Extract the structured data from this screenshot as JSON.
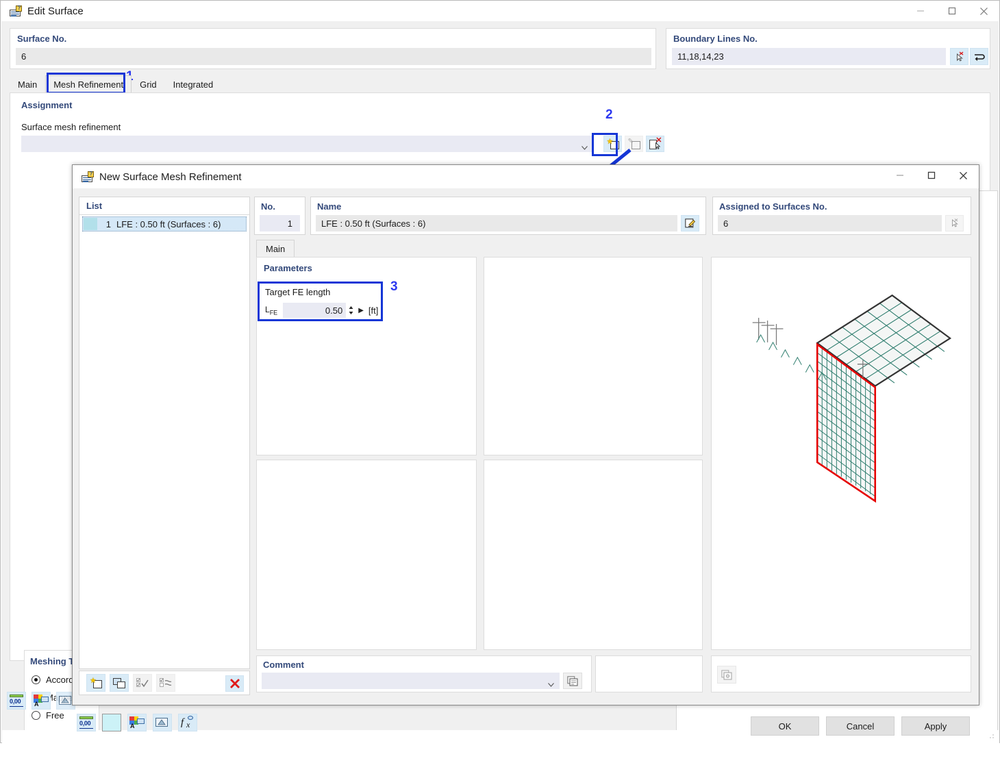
{
  "parent_window": {
    "title": "Edit Surface",
    "icon": "app-window-icon",
    "controls": {
      "minimize": "minimize-icon",
      "maximize": "maximize-icon",
      "close": "close-icon"
    },
    "surface_no": {
      "label": "Surface No.",
      "value": "6"
    },
    "boundary_lines": {
      "label": "Boundary Lines No.",
      "value": "11,18,14,23",
      "buttons": [
        "pick-lines-icon",
        "reverse-icon"
      ]
    },
    "tabs": [
      {
        "label": "Main",
        "active": false
      },
      {
        "label": "Mesh Refinement",
        "active": true
      },
      {
        "label": "Grid",
        "active": false
      },
      {
        "label": "Integrated",
        "active": false
      }
    ],
    "assignment": {
      "label": "Assignment",
      "field_label": "Surface mesh refinement",
      "combo_value": "",
      "combo_placeholder": "",
      "buttons": [
        "new-icon",
        "edit-icon",
        "delete-icon"
      ]
    },
    "meshing_type": {
      "label": "Meshing Ty",
      "options": [
        {
          "label": "Accordin",
          "selected": true
        },
        {
          "label": "Mapped",
          "selected": false
        },
        {
          "label": "Free",
          "selected": false
        }
      ]
    },
    "bottom_toolbar": [
      "numeric-format-icon",
      "display-properties-icon",
      "render-icon"
    ],
    "footer_buttons": [
      {
        "label": "OK",
        "name": "ok-button"
      },
      {
        "label": "Cancel",
        "name": "cancel-button"
      },
      {
        "label": "Apply",
        "name": "apply-button"
      }
    ]
  },
  "child_dialog": {
    "title": "New Surface Mesh Refinement",
    "icon": "app-window-icon",
    "controls": {
      "minimize": "minimize-icon",
      "maximize": "maximize-icon",
      "close": "close-icon"
    },
    "list": {
      "header": "List",
      "rows": [
        {
          "num": "1",
          "name": "LFE : 0.50 ft (Surfaces : 6)",
          "selected": true
        }
      ],
      "toolbar": [
        "new-icon",
        "copy-icon",
        "select-all-icon",
        "invert-selection-icon",
        "delete-icon"
      ]
    },
    "no_field": {
      "label": "No.",
      "value": "1"
    },
    "name_field": {
      "label": "Name",
      "value": "LFE : 0.50 ft (Surfaces : 6)",
      "button": "edit-name-icon"
    },
    "assigned_field": {
      "label": "Assigned to Surfaces No.",
      "value": "6",
      "button": "pick-surfaces-icon"
    },
    "tabs": [
      {
        "label": "Main",
        "active": true
      }
    ],
    "parameters": {
      "label": "Parameters",
      "target_fe_length": {
        "group_label": "Target FE length",
        "symbol": "L",
        "symbol_sub": "FE",
        "value": "0.50",
        "unit": "[ft]"
      }
    },
    "comment": {
      "label": "Comment",
      "value": "",
      "button": "comment-library-icon"
    },
    "preview_footer_button": "preview-settings-icon",
    "bottom_toolbar": [
      "numeric-format-icon",
      "color-swatch-icon",
      "display-properties-icon",
      "render-icon",
      "formula-icon"
    ]
  },
  "annotations": [
    {
      "id": "1",
      "label": "1",
      "color": "#2d39f0"
    },
    {
      "id": "2",
      "label": "2",
      "color": "#2d39f0"
    },
    {
      "id": "3",
      "label": "3",
      "color": "#2d39f0"
    }
  ],
  "colors": {
    "annotation_blue": "#2d39f0",
    "highlight_box": "#1536d6",
    "field_label": "#33497a",
    "mesh_green": "#2e7d6e",
    "boundary_red": "#e60000",
    "edge_dark": "#333333"
  },
  "preview_model": {
    "description": "Isometric view of a horizontal slab and a vertical wall with FE mesh",
    "horizontal_panel": {
      "divisions_u": 6,
      "divisions_v": 6,
      "edge_color": "#333333"
    },
    "vertical_panel": {
      "divisions_u": 12,
      "divisions_v": 14,
      "edge_color": "#e60000"
    }
  }
}
